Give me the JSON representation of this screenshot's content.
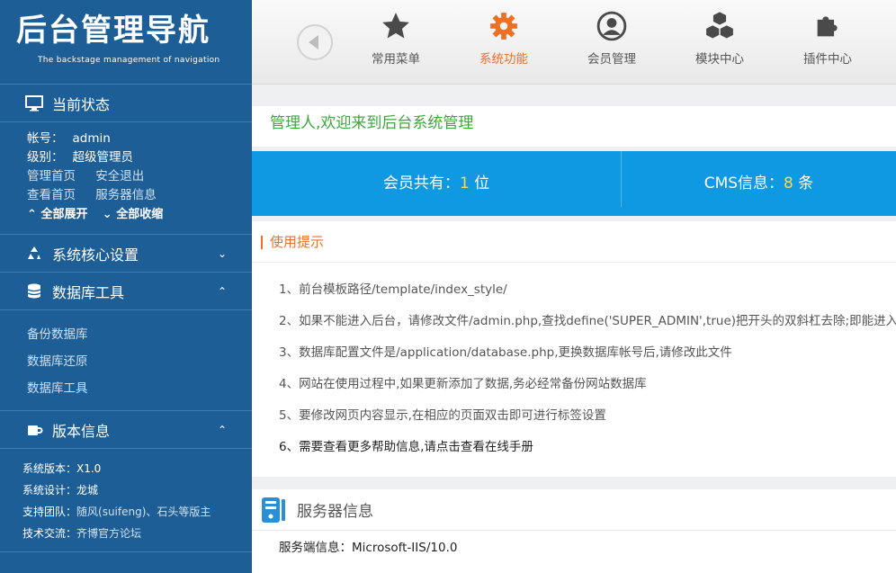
{
  "logo": {
    "title": "后台管理导航",
    "subtitle": "The backstage management of navigation"
  },
  "sidebar": {
    "status": {
      "title": "当前状态",
      "account_label": "帐号：",
      "account_value": "admin",
      "level_label": "级别：",
      "level_value": "超级管理员",
      "links_row1": [
        "管理首页",
        "安全退出"
      ],
      "links_row2": [
        "查看首页",
        "服务器信息"
      ],
      "expand_all": "全部展开",
      "collapse_all": "全部收缩"
    },
    "core_settings": {
      "title": "系统核心设置"
    },
    "db_tools": {
      "title": "数据库工具",
      "items": [
        "备份数据库",
        "数据库还原",
        "数据库工具"
      ]
    },
    "version": {
      "title": "版本信息",
      "version_label": "系统版本：",
      "version_value": "X1.0",
      "design_label": "系统设计：",
      "design_value": "龙城",
      "team_label": "支持团队：",
      "team_value": "随风(suifeng)、石头等版主",
      "exchange_label": "技术交流：",
      "exchange_value": "齐博官方论坛"
    }
  },
  "topnav": {
    "items": [
      {
        "label": "常用菜单",
        "icon": "star-icon"
      },
      {
        "label": "系统功能",
        "icon": "gear-icon"
      },
      {
        "label": "会员管理",
        "icon": "user-icon"
      },
      {
        "label": "模块中心",
        "icon": "cubes-icon"
      },
      {
        "label": "插件中心",
        "icon": "puzzle-icon"
      }
    ],
    "active_index": 1
  },
  "main": {
    "welcome": "管理人,欢迎来到后台系统管理",
    "stats": {
      "members_prefix": "会员共有：",
      "members_value": "1",
      "members_suffix": " 位",
      "cms_prefix": "CMS信息：",
      "cms_value": "8",
      "cms_suffix": " 条"
    },
    "tips": {
      "title": "使用提示",
      "items": [
        "1、前台模板路径/template/index_style/",
        "2、如果不能进入后台，请修改文件/admin.php,查找define('SUPER_ADMIN',true)把开头的双斜杠去除;即能进入",
        "3、数据库配置文件是/application/database.php,更换数据库帐号后,请修改此文件",
        "4、网站在使用过程中,如果更新添加了数据,务必经常备份网站数据库",
        "5、要修改网页内容显示,在相应的页面双击即可进行标签设置",
        "6、需要查看更多帮助信息,请点击查看在线手册"
      ]
    },
    "server": {
      "title": "服务器信息",
      "row_label": "服务端信息：",
      "row_value": "Microsoft-IIS/10.0"
    }
  },
  "colors": {
    "sidebar": "#1e5e96",
    "accent": "#ee7024",
    "stats_bg": "#0f99e2",
    "welcome": "#3ca83b",
    "highlight": "#ffd84e"
  }
}
